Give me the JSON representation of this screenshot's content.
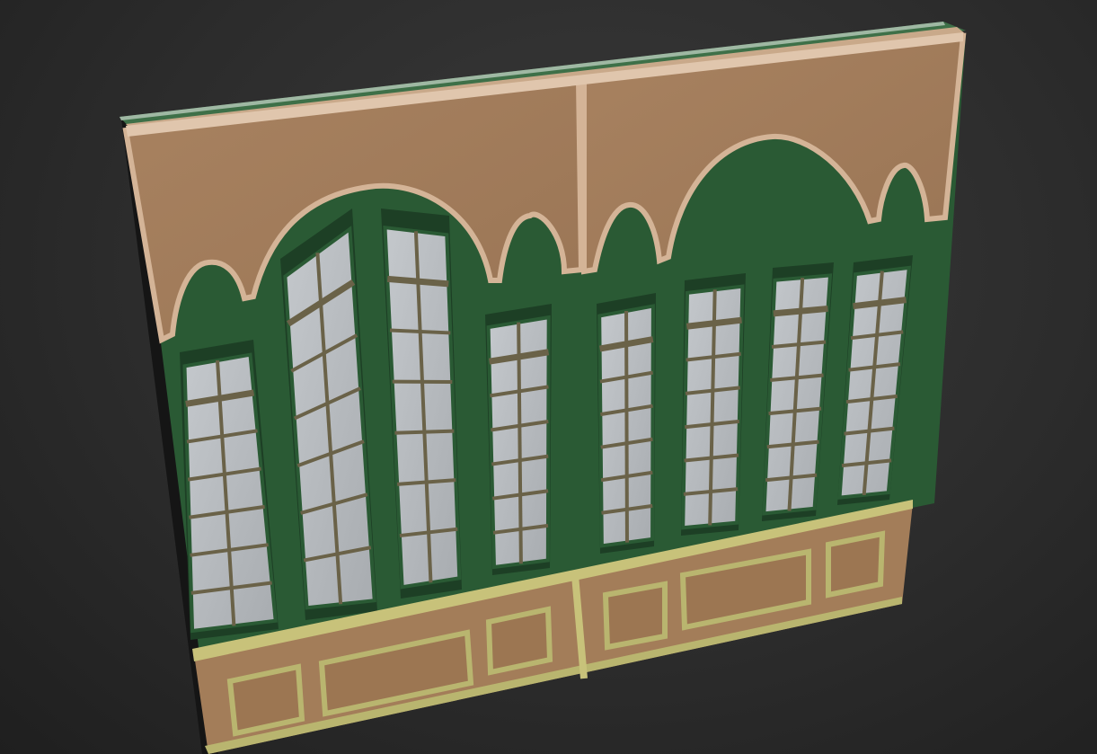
{
  "scene": {
    "subject": "",
    "colors": {
      "background": "#2e2e2e",
      "frame_green": "#2a5a34",
      "frame_green_dark": "#1d3f25",
      "glass": "#b8bcc0",
      "muntin": "#6a6248",
      "upper_wall": "#a27c5a",
      "trim": "#d4b497",
      "trim_shadow": "#9c7c62",
      "wainscot": "#a37d59",
      "wainscot_trim": "#b9b56f",
      "edge": "#1b1b1b"
    }
  }
}
